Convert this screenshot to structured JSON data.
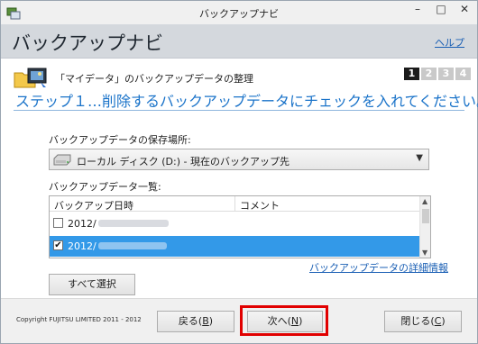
{
  "window": {
    "title": "バックアップナビ",
    "minimize": "–",
    "maximize": "□",
    "close": "✕"
  },
  "header": {
    "title": "バックアップナビ",
    "help_link": "ヘルプ"
  },
  "section": {
    "title": "「マイデータ」のバックアップデータの整理",
    "steps": [
      "1",
      "2",
      "3",
      "4"
    ],
    "active_step": 1,
    "heading": "ステップ１…削除するバックアップデータにチェックを入れてください。"
  },
  "storage": {
    "label": "バックアップデータの保存場所:",
    "selected": "ローカル ディスク (D:) - 現在のバックアップ先",
    "dropdown_icon": "chevron-down-icon"
  },
  "backup_list": {
    "label": "バックアップデータ一覧:",
    "columns": [
      "バックアップ日時",
      "コメント"
    ],
    "rows": [
      {
        "date": "2012/",
        "checked": false,
        "selected": false
      },
      {
        "date": "2012/",
        "checked": true,
        "selected": true
      }
    ]
  },
  "detail_link": "バックアップデータの詳細情報",
  "select_all_button": "すべて選択",
  "footer": {
    "copyright": "Copyright FUJITSU LIMITED 2011 - 2012",
    "back_button": "戻る(",
    "back_key": "B",
    "next_button": "次へ(",
    "next_key": "N",
    "close_button": "閉じる(",
    "close_key": "C",
    "paren_close": ")"
  },
  "colors": {
    "accent": "#1a73c9",
    "selection": "#3399e8",
    "highlight_box": "#e10000",
    "header_band": "#d4d8dd"
  }
}
